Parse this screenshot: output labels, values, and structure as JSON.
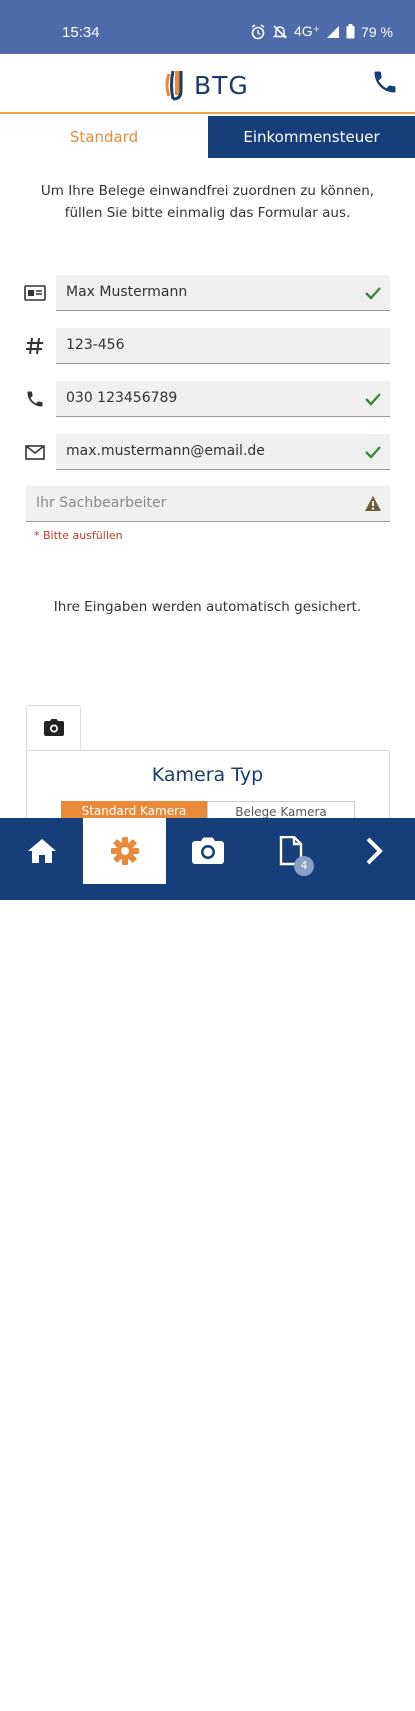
{
  "status_bar": {
    "time": "15:34",
    "network": "4G⁺",
    "battery": "79 %"
  },
  "header": {
    "logo_text": "BTG",
    "brand_color": "#163e7a",
    "accent_color": "#e88a3a"
  },
  "tabs": [
    {
      "label": "Standard",
      "active": true
    },
    {
      "label": "Einkommensteuer",
      "active": false
    }
  ],
  "form": {
    "intro": "Um Ihre Belege einwandfrei zuordnen zu können, füllen Sie bitte einmalig das Formular aus.",
    "fields": [
      {
        "icon": "id-card-icon",
        "value": "Max Mustermann",
        "status": "check"
      },
      {
        "icon": "hash-icon",
        "value": "123-456",
        "status": "none"
      },
      {
        "icon": "phone-icon",
        "value": "030 123456789",
        "status": "check"
      },
      {
        "icon": "mail-icon",
        "value": "max.mustermann@email.de",
        "status": "check"
      }
    ],
    "required_field": {
      "placeholder": "Ihr Sachbearbeiter",
      "status": "warning",
      "hint": "* Bitte ausfüllen"
    },
    "autosave_note": "Ihre Eingaben werden automatisch gesichert."
  },
  "camera": {
    "tab_icon": "camera-icon",
    "title": "Kamera Typ",
    "options": [
      "Standard Kamera",
      "Belege Kamera"
    ],
    "selected": "Standard Kamera"
  },
  "bottom_nav": {
    "items": [
      {
        "icon": "home-icon",
        "active": false
      },
      {
        "icon": "gear-icon",
        "active": true
      },
      {
        "icon": "camera-icon",
        "active": false
      },
      {
        "icon": "document-icon",
        "active": false,
        "badge": "4"
      },
      {
        "icon": "chevron-right-icon",
        "active": false
      }
    ]
  }
}
